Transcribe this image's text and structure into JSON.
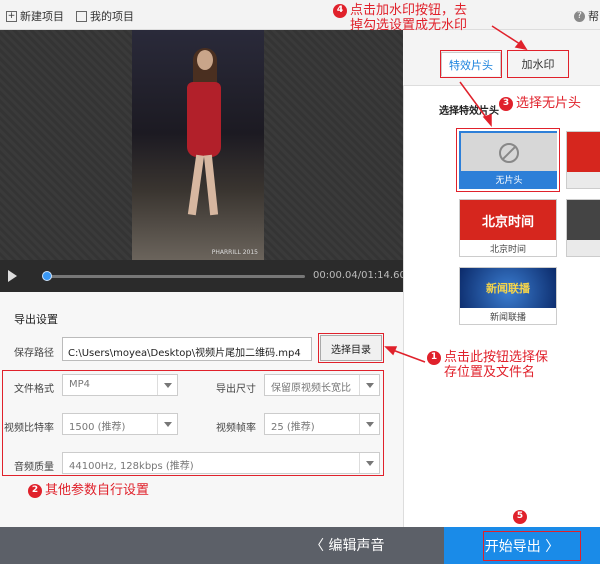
{
  "toolbar": {
    "new_project": "新建项目",
    "my_projects": "我的项目",
    "help": "帮"
  },
  "player": {
    "timecode": "00:00.04/01:14.60",
    "watermark": "PHARRILL 2015",
    "progress": 0.0005
  },
  "export_settings": {
    "title": "导出设置",
    "save_path_label": "保存路径",
    "save_path_value": "C:\\Users\\moyea\\Desktop\\视频片尾加二维码.mp4",
    "choose_dir_button": "选择目录",
    "format_label": "文件格式",
    "format_value": "MP4",
    "size_label": "导出尺寸",
    "size_value": "保留原视频长宽比",
    "bitrate_label": "视频比特率",
    "bitrate_value": "1500 (推荐)",
    "framerate_label": "视频帧率",
    "framerate_value": "25 (推荐)",
    "audio_label": "音频质量",
    "audio_value": "44100Hz, 128kbps (推荐)"
  },
  "right_panel": {
    "tabs": [
      {
        "label": "特效片头",
        "active": true
      },
      {
        "label": "加水印",
        "active": false
      }
    ],
    "heading": "选择特效片头",
    "intros": [
      {
        "label": "无片头",
        "selected": true
      },
      {
        "label": "北京时间",
        "image_text": "北京时间",
        "selected": false
      },
      {
        "label": "新闻联播",
        "image_text": "新闻联播",
        "selected": false
      }
    ]
  },
  "bottom": {
    "audio_button": "〈 编辑声音",
    "export_button": "开始导出 〉"
  },
  "annotations": {
    "a1_num": "1",
    "a1_text_line1": "点击此按钮选择保",
    "a1_text_line2": "存位置及文件名",
    "a2_num": "2",
    "a2_text": "其他参数自行设置",
    "a3_num": "3",
    "a3_text": "选择无片头",
    "a4_num": "4",
    "a4_text_line1": "点击加水印按钮，去",
    "a4_text_line2": "掉勾选设置成无水印",
    "a5_num": "5"
  },
  "colors": {
    "accent": "#1a8be8",
    "annotation_red": "#e0212b",
    "bottom_bar": "#5c6068"
  }
}
